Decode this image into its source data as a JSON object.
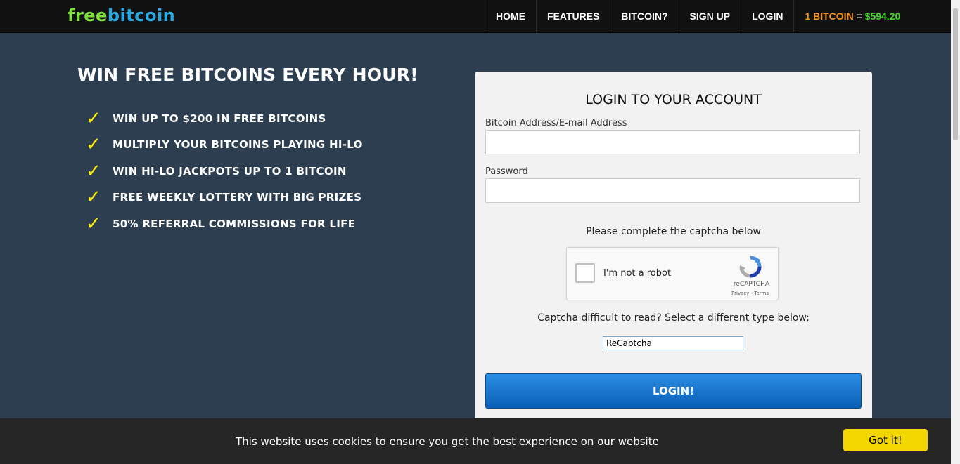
{
  "header": {
    "logo_part1": "free",
    "logo_part2": "bitcoin",
    "nav": [
      "HOME",
      "FEATURES",
      "BITCOIN?",
      "SIGN UP",
      "LOGIN"
    ],
    "price_label": "1 BITCOIN",
    "price_eq": " = ",
    "price_value": "$594.20"
  },
  "hero": {
    "headline": "WIN FREE BITCOINS EVERY HOUR!",
    "check_glyph": "✓",
    "features": [
      "WIN UP TO $200 IN FREE BITCOINS",
      "MULTIPLY YOUR BITCOINS PLAYING HI-LO",
      "WIN HI-LO JACKPOTS UP TO 1 BITCOIN",
      "FREE WEEKLY LOTTERY WITH BIG PRIZES",
      "50% REFERRAL COMMISSIONS FOR LIFE"
    ]
  },
  "login": {
    "title": "LOGIN TO YOUR ACCOUNT",
    "address_label": "Bitcoin Address/E-mail Address",
    "address_value": "",
    "password_label": "Password",
    "password_value": "",
    "captcha_prompt": "Please complete the captcha below",
    "recaptcha_label": "I'm not a robot",
    "recaptcha_brand": "reCAPTCHA",
    "recaptcha_links": "Privacy - Terms",
    "captcha_alt_prompt": "Captcha difficult to read? Select a different type below:",
    "captcha_type_selected": "ReCaptcha",
    "button": "LOGIN!"
  },
  "cookie": {
    "text": "This website uses cookies to ensure you get the best experience on our website",
    "button": "Got it!"
  },
  "colors": {
    "page_bg": "#2c3e50",
    "nav_bg": "#111111",
    "logo_green": "#7ee03a",
    "logo_blue": "#27a9e1",
    "btc_orange": "#f7931a",
    "price_green": "#44d62c",
    "check_yellow": "#ffee00",
    "login_blue": "#1778d2",
    "cookie_button": "#f1d600"
  },
  "icons": {
    "feature": "checkmark-icon",
    "recaptcha": "recaptcha-logo-icon"
  }
}
